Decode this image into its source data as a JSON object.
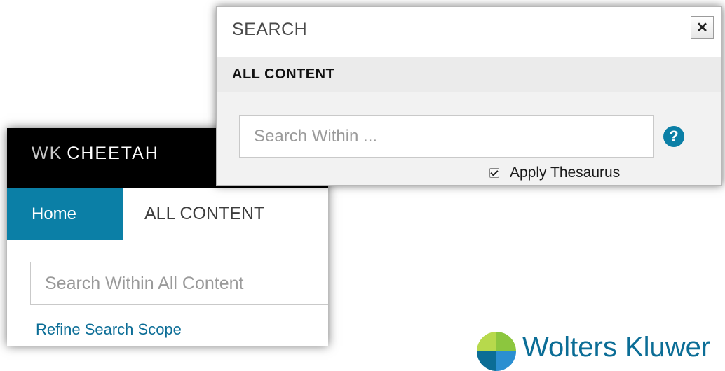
{
  "app": {
    "brand_prefix": "WK",
    "brand_name": "CHEETAH",
    "tabs": [
      {
        "label": "Home",
        "active": true
      },
      {
        "label": "ALL CONTENT",
        "active": false
      }
    ],
    "search": {
      "placeholder": "Search Within All Content",
      "value": ""
    },
    "refine_link": "Refine Search Scope",
    "accent_color": "#0b7fa6"
  },
  "dialog": {
    "title": "SEARCH",
    "close_symbol": "✕",
    "section_title": "ALL CONTENT",
    "search": {
      "placeholder": "Search Within ...",
      "value": ""
    },
    "help_symbol": "?",
    "apply_thesaurus": {
      "label": "Apply Thesaurus",
      "checked": true
    }
  },
  "footer_logo": {
    "text": "Wolters Kluwer",
    "icon": "logo-icon"
  }
}
